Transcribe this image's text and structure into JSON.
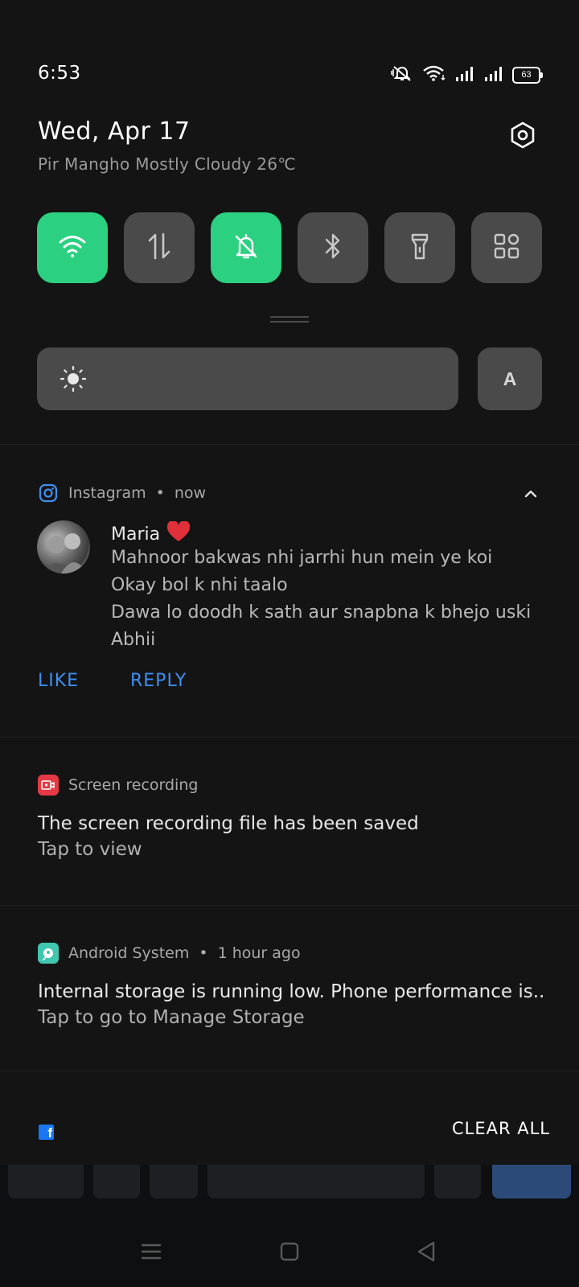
{
  "status_bar": {
    "time": "6:53",
    "battery_level": "63"
  },
  "header": {
    "date": "Wed, Apr 17",
    "weather": "Pir Mangho Mostly Cloudy 26℃"
  },
  "quick_toggles": [
    {
      "name": "wifi",
      "icon": "wifi-icon",
      "on": true
    },
    {
      "name": "mobile-data",
      "icon": "data-transfer-icon",
      "on": false
    },
    {
      "name": "silent",
      "icon": "bell-off-icon",
      "on": true
    },
    {
      "name": "bluetooth",
      "icon": "bluetooth-icon",
      "on": false
    },
    {
      "name": "flashlight",
      "icon": "flashlight-icon",
      "on": false
    },
    {
      "name": "more",
      "icon": "grid-icon",
      "on": false
    }
  ],
  "brightness": {
    "auto_label": "A"
  },
  "notifications": {
    "instagram": {
      "app": "Instagram",
      "separator": "•",
      "time": "now",
      "sender": "Maria",
      "messages": [
        "Mahnoor bakwas nhi jarrhi hun mein ye koi",
        "Okay bol k nhi taalo",
        "Dawa lo doodh k sath aur snapbna k bhejo uski",
        "Abhii"
      ],
      "like_label": "LIKE",
      "reply_label": "REPLY"
    },
    "screen_recording": {
      "app": "Screen recording",
      "title": "The screen recording file has been saved",
      "subtitle": "Tap to view"
    },
    "android_system": {
      "app": "Android System",
      "separator": "•",
      "time": "1 hour ago",
      "title": "Internal storage is running low. Phone performance is..",
      "subtitle": "Tap to go to Manage Storage"
    }
  },
  "footer": {
    "fb_icon_letter": "f",
    "clear_all": "CLEAR ALL"
  },
  "colors": {
    "accent_green": "#2bd181",
    "link_blue": "#3c8ff3",
    "instagram_blue": "#3d8ff0",
    "screen_rec_red": "#e53945",
    "android_teal": "#3fc7b0"
  }
}
